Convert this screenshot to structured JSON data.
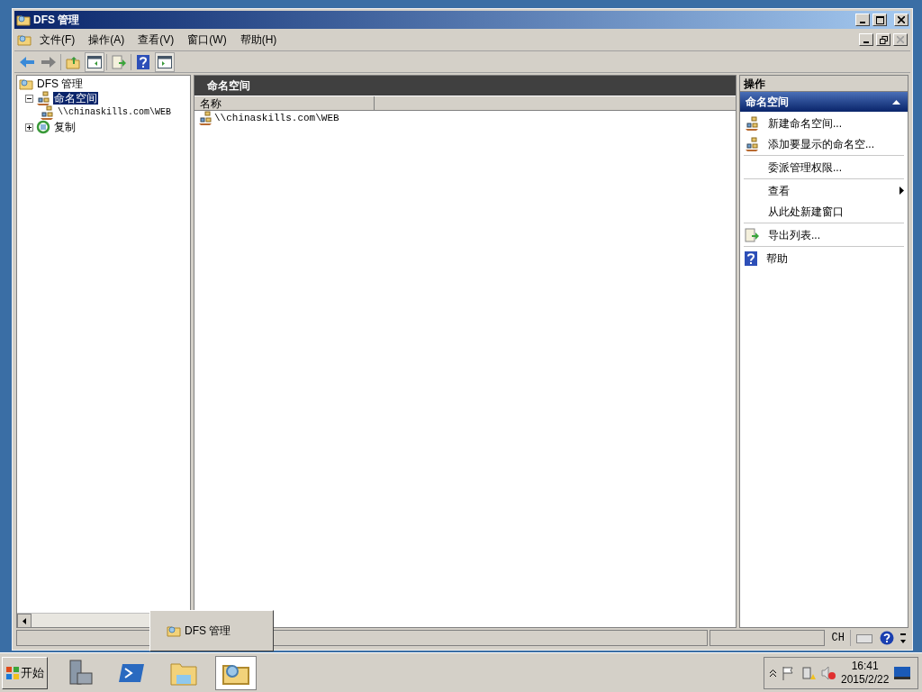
{
  "window": {
    "title": "DFS 管理"
  },
  "menu": [
    "文件(F)",
    "操作(A)",
    "查看(V)",
    "窗口(W)",
    "帮助(H)"
  ],
  "tree": [
    {
      "label": "DFS 管理",
      "kind": "root",
      "selected": false,
      "children": [
        {
          "label": "命名空间",
          "kind": "namespace",
          "selected": true,
          "expanded": true,
          "children": [
            {
              "label": "\\\\chinaskills.com\\WEB",
              "kind": "share",
              "selected": false
            }
          ]
        },
        {
          "label": "复制",
          "kind": "replication",
          "selected": false,
          "expanded": false
        }
      ]
    }
  ],
  "list": {
    "header": "命名空间",
    "columns": [
      "名称"
    ],
    "rows": [
      {
        "name": "\\\\chinaskills.com\\WEB"
      }
    ]
  },
  "actions": {
    "title": "操作",
    "section": "命名空间",
    "expanded": true,
    "groups": [
      [
        {
          "label": "新建命名空间...",
          "kind": "new"
        },
        {
          "label": "添加要显示的命名空...",
          "kind": "add"
        }
      ],
      [
        {
          "label": "委派管理权限...",
          "kind": "plain"
        }
      ],
      [
        {
          "label": "查看",
          "kind": "submenu"
        },
        {
          "label": "从此处新建窗口",
          "kind": "plain"
        }
      ],
      [
        {
          "label": "导出列表...",
          "kind": "export"
        }
      ],
      [
        {
          "label": "帮助",
          "kind": "help"
        }
      ]
    ]
  },
  "status_bar": {
    "language": "CH"
  },
  "taskbar": {
    "start": "开始",
    "apps": [
      {
        "kind": "server",
        "selected": false
      },
      {
        "kind": "shell",
        "selected": false
      },
      {
        "kind": "explorer",
        "selected": false
      },
      {
        "kind": "dfs",
        "selected": true
      }
    ],
    "preview": "DFS 管理",
    "time": "16:41",
    "date": "2015/2/22"
  }
}
